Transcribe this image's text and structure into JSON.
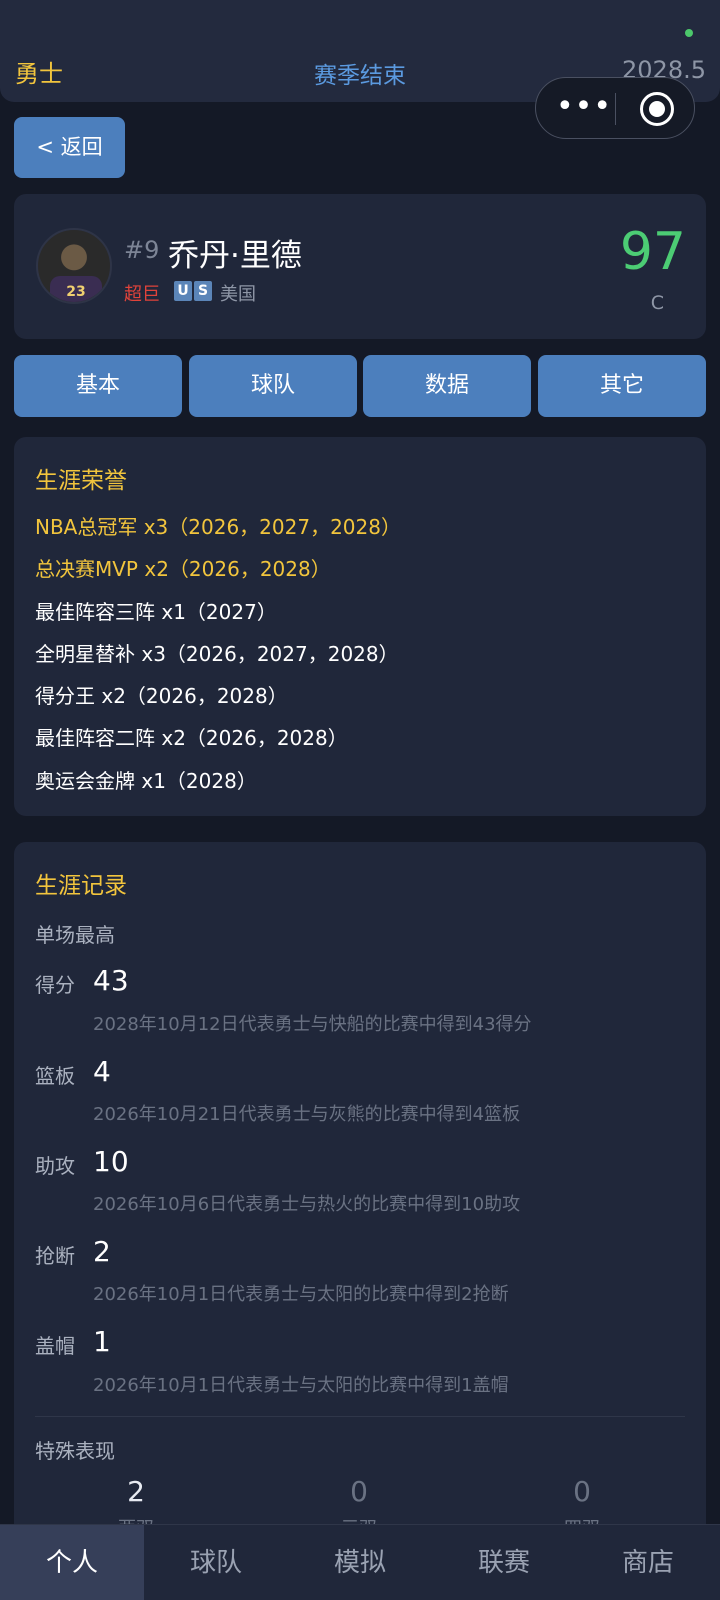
{
  "header": {
    "team": "勇士",
    "status": "赛季结束",
    "season": "2028.5",
    "more_glyph": "•••",
    "icons": [
      "more-dots-icon",
      "target-close-icon"
    ]
  },
  "back_button": "< 返回",
  "player": {
    "number": "#9",
    "name": "乔丹·里德",
    "tag": "超巨",
    "country_code": [
      "U",
      "S"
    ],
    "country": "美国",
    "rating": "97",
    "position": "C",
    "jersey_number": "23"
  },
  "tabs": [
    "基本",
    "球队",
    "数据",
    "其它"
  ],
  "honors": {
    "title": "生涯荣誉",
    "items": [
      {
        "text": "NBA总冠军 x3（2026，2027，2028）",
        "highlight": true
      },
      {
        "text": "总决赛MVP x2（2026，2028）",
        "highlight": true
      },
      {
        "text": "最佳阵容三阵 x1（2027）",
        "highlight": false
      },
      {
        "text": "全明星替补 x3（2026，2027，2028）",
        "highlight": false
      },
      {
        "text": "得分王 x2（2026，2028）",
        "highlight": false
      },
      {
        "text": "最佳阵容二阵 x2（2026，2028）",
        "highlight": false
      },
      {
        "text": "奥运会金牌 x1（2028）",
        "highlight": false
      }
    ]
  },
  "records": {
    "title": "生涯记录",
    "single_game_title": "单场最高",
    "items": [
      {
        "label": "得分",
        "value": "43",
        "desc": "2028年10月12日代表勇士与快船的比赛中得到43得分"
      },
      {
        "label": "篮板",
        "value": "4",
        "desc": "2026年10月21日代表勇士与灰熊的比赛中得到4篮板"
      },
      {
        "label": "助攻",
        "value": "10",
        "desc": "2026年10月6日代表勇士与热火的比赛中得到10助攻"
      },
      {
        "label": "抢断",
        "value": "2",
        "desc": "2026年10月1日代表勇士与太阳的比赛中得到2抢断"
      },
      {
        "label": "盖帽",
        "value": "1",
        "desc": "2026年10月1日代表勇士与太阳的比赛中得到1盖帽"
      }
    ],
    "special_title": "特殊表现",
    "special": [
      {
        "value": "2",
        "label": "两双"
      },
      {
        "value": "0",
        "label": "三双"
      },
      {
        "value": "0",
        "label": "四双"
      }
    ]
  },
  "nav": {
    "items": [
      "个人",
      "球队",
      "模拟",
      "联赛",
      "商店"
    ],
    "active": 0
  },
  "colors": {
    "background": "#141926",
    "card": "#20273a",
    "accent_blue": "#4c7fbd",
    "gold": "#f2c53d",
    "rating_green": "#4ccc74",
    "tag_red": "#e0433a"
  }
}
